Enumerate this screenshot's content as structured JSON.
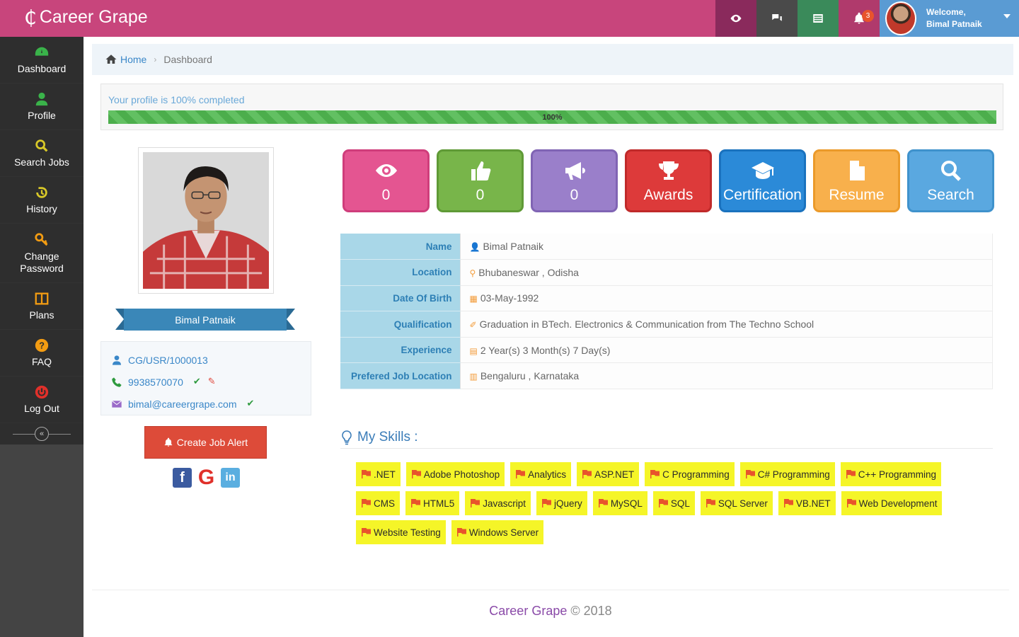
{
  "header": {
    "brand": "Career Grape",
    "notification_count": "3",
    "welcome_line1": "Welcome,",
    "welcome_line2": "Bimal Patnaik"
  },
  "sidebar": {
    "items": [
      {
        "label": "Dashboard",
        "icon": "dashboard-icon",
        "color": "#3ab34a"
      },
      {
        "label": "Profile",
        "icon": "user-icon",
        "color": "#3ab34a"
      },
      {
        "label": "Search Jobs",
        "icon": "search-icon",
        "color": "#d8c828"
      },
      {
        "label": "History",
        "icon": "history-icon",
        "color": "#d8c828"
      },
      {
        "label": "Change Password",
        "icon": "key-icon",
        "color": "#f39c12"
      },
      {
        "label": "Plans",
        "icon": "columns-icon",
        "color": "#f39c12"
      },
      {
        "label": "FAQ",
        "icon": "question-icon",
        "color": "#f39c12"
      },
      {
        "label": "Log Out",
        "icon": "power-icon",
        "color": "#e0302a"
      }
    ]
  },
  "breadcrumb": {
    "home": "Home",
    "current": "Dashboard"
  },
  "profile_progress": {
    "text": "Your profile is 100% completed",
    "percent_label": "100%",
    "percent": 100
  },
  "profile": {
    "name": "Bimal Patnaik",
    "user_id": "CG/USR/1000013",
    "phone": "9938570070",
    "email": "bimal@careergrape.com",
    "create_alert_label": "Create Job Alert"
  },
  "tiles": [
    {
      "label": "0",
      "icon": "eye-icon"
    },
    {
      "label": "0",
      "icon": "thumbs-up-icon"
    },
    {
      "label": "0",
      "icon": "bullhorn-icon"
    },
    {
      "label": "Awards",
      "icon": "trophy-icon"
    },
    {
      "label": "Certification",
      "icon": "graduation-cap-icon"
    },
    {
      "label": "Resume",
      "icon": "document-icon"
    },
    {
      "label": "Search",
      "icon": "search-icon"
    }
  ],
  "details": [
    {
      "label": "Name",
      "value": "Bimal Patnaik",
      "icon": "user-icon"
    },
    {
      "label": "Location",
      "value": "Bhubaneswar , Odisha",
      "icon": "map-marker-icon"
    },
    {
      "label": "Date Of Birth",
      "value": "03-May-1992",
      "icon": "calendar-icon"
    },
    {
      "label": "Qualification",
      "value": "Graduation in BTech. Electronics & Communication from The Techno School",
      "icon": "certificate-icon"
    },
    {
      "label": "Experience",
      "value": "2 Year(s) 3 Month(s) 7 Day(s)",
      "icon": "briefcase-icon"
    },
    {
      "label": "Prefered Job Location",
      "value": "Bengaluru , Karnataka",
      "icon": "map-icon"
    }
  ],
  "skills": {
    "title": "My Skills :",
    "items": [
      ".NET",
      "Adobe Photoshop",
      "Analytics",
      "ASP.NET",
      "C Programming",
      "C# Programming",
      "C++ Programming",
      "CMS",
      "HTML5",
      "Javascript",
      "jQuery",
      "MySQL",
      "SQL",
      "SQL Server",
      "VB.NET",
      "Web Development",
      "Website Testing",
      "Windows Server"
    ]
  },
  "footer": {
    "brand": "Career Grape",
    "copyright": "© 2018"
  },
  "colors": {
    "header": "#c8457c",
    "sidebar": "#2e2e2e",
    "skill_tag": "#f5f528",
    "label_cell": "#a9d7e8"
  }
}
